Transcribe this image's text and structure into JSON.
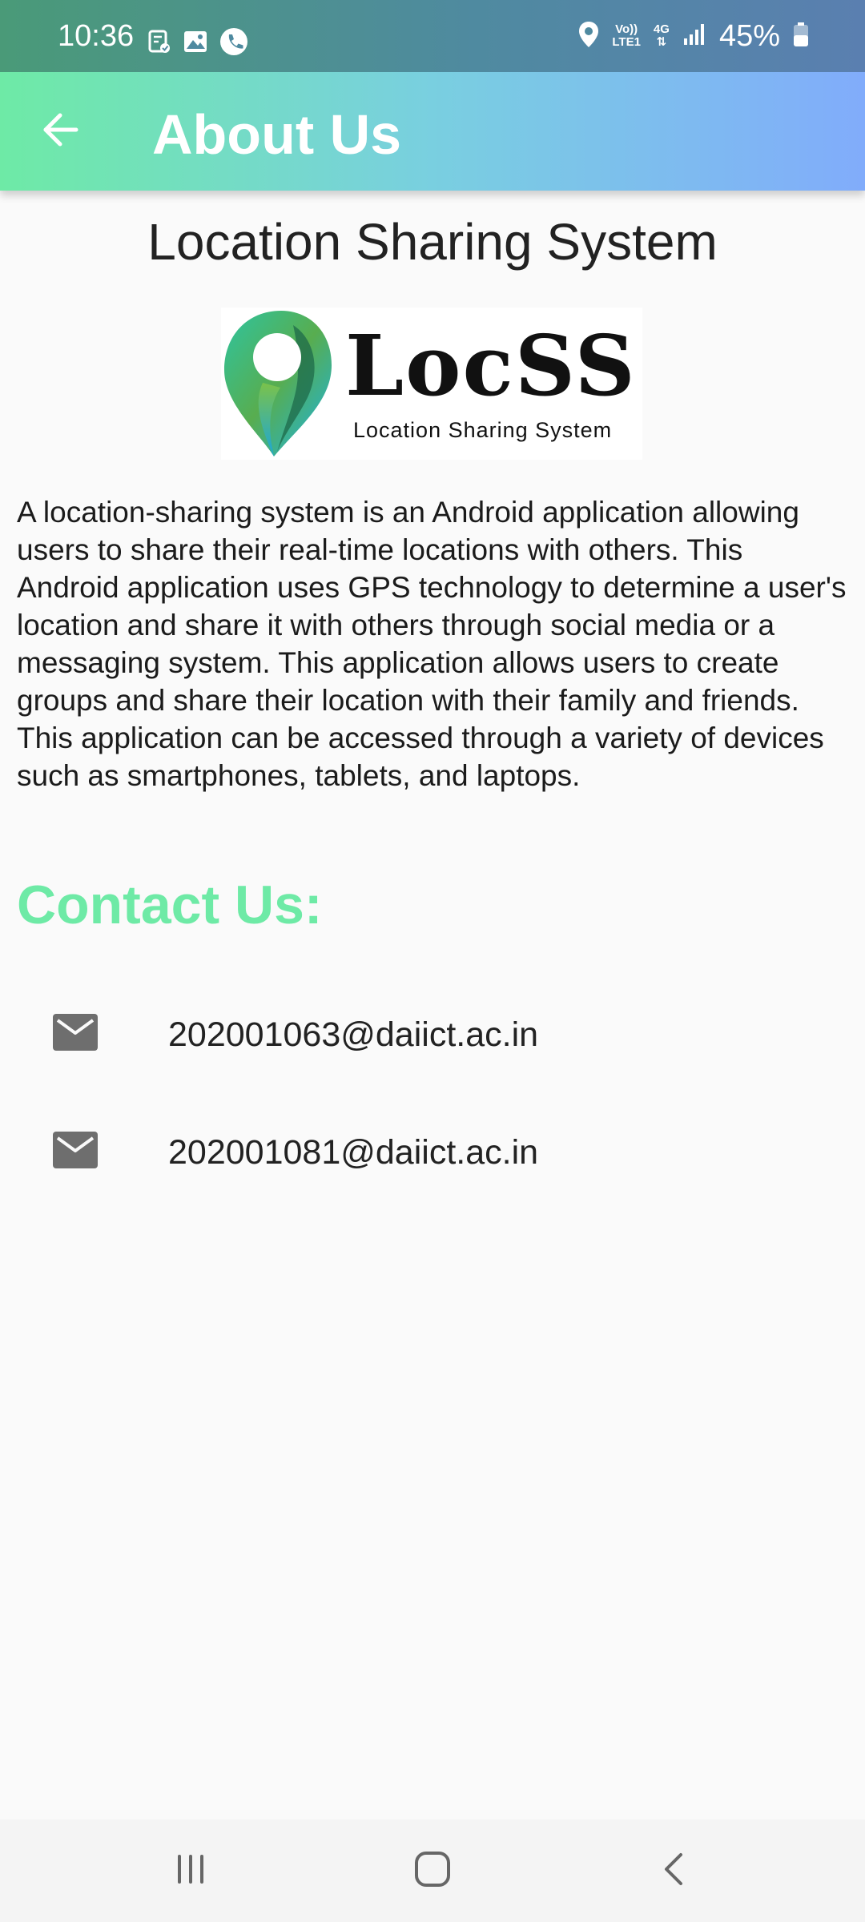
{
  "status_bar": {
    "time": "10:36",
    "battery": "45%",
    "network_top": "Vo))",
    "network_bottom": "LTE1",
    "network_type": "4G",
    "icons_left": [
      "clipboard-check-icon",
      "image-icon",
      "phone-icon"
    ],
    "icons_right": [
      "location-pin-icon",
      "volte-icon",
      "signal-icon",
      "battery-icon"
    ]
  },
  "app_bar": {
    "title": "About Us",
    "back_icon": "arrow-back-icon",
    "gradient_colors": [
      "#6eeaa6",
      "#81acfb"
    ]
  },
  "main": {
    "title": "Location Sharing System",
    "logo": {
      "wordmark": "LocSS",
      "tagline": "Location Sharing System"
    },
    "description": "A location-sharing system is an Android application allowing users to share their real-time locations with others. This Android application uses GPS technology to determine a user's location and share it with others through social media or a messaging system. This application allows users to create groups and share their location with their family and friends. This application can be accessed through a variety of devices such as smartphones, tablets, and laptops.",
    "contact_heading": "Contact Us:",
    "contact_heading_color": "#6eeaa6",
    "contacts": [
      {
        "icon": "email-icon",
        "email": "202001063@daiict.ac.in"
      },
      {
        "icon": "email-icon",
        "email": "202001081@daiict.ac.in"
      }
    ]
  },
  "nav_bar": {
    "buttons": [
      "recents-icon",
      "home-icon",
      "back-icon"
    ]
  }
}
